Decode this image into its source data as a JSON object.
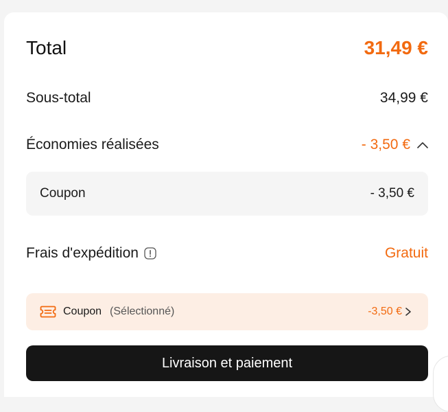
{
  "summary": {
    "total_label": "Total",
    "total_value": "31,49 €",
    "subtotal_label": "Sous-total",
    "subtotal_value": "34,99 €",
    "savings_label": "Économies réalisées",
    "savings_value": "- 3,50 €",
    "savings_breakdown": [
      {
        "label": "Coupon",
        "value": "- 3,50 €"
      }
    ],
    "shipping_label": "Frais d'expédition",
    "shipping_value": "Gratuit"
  },
  "coupon_bar": {
    "title": "Coupon",
    "status": "(Sélectionné)",
    "value": "-3,50 €"
  },
  "checkout": {
    "button_label": "Livraison et paiement"
  },
  "colors": {
    "accent": "#f26a10",
    "coupon_bar_bg": "#fdeee4",
    "button_bg": "#161616"
  },
  "icons": {
    "savings_toggle": "chevron-up-icon",
    "shipping_info": "info-icon",
    "coupon": "coupon-ticket-icon",
    "coupon_open": "chevron-right-icon"
  }
}
